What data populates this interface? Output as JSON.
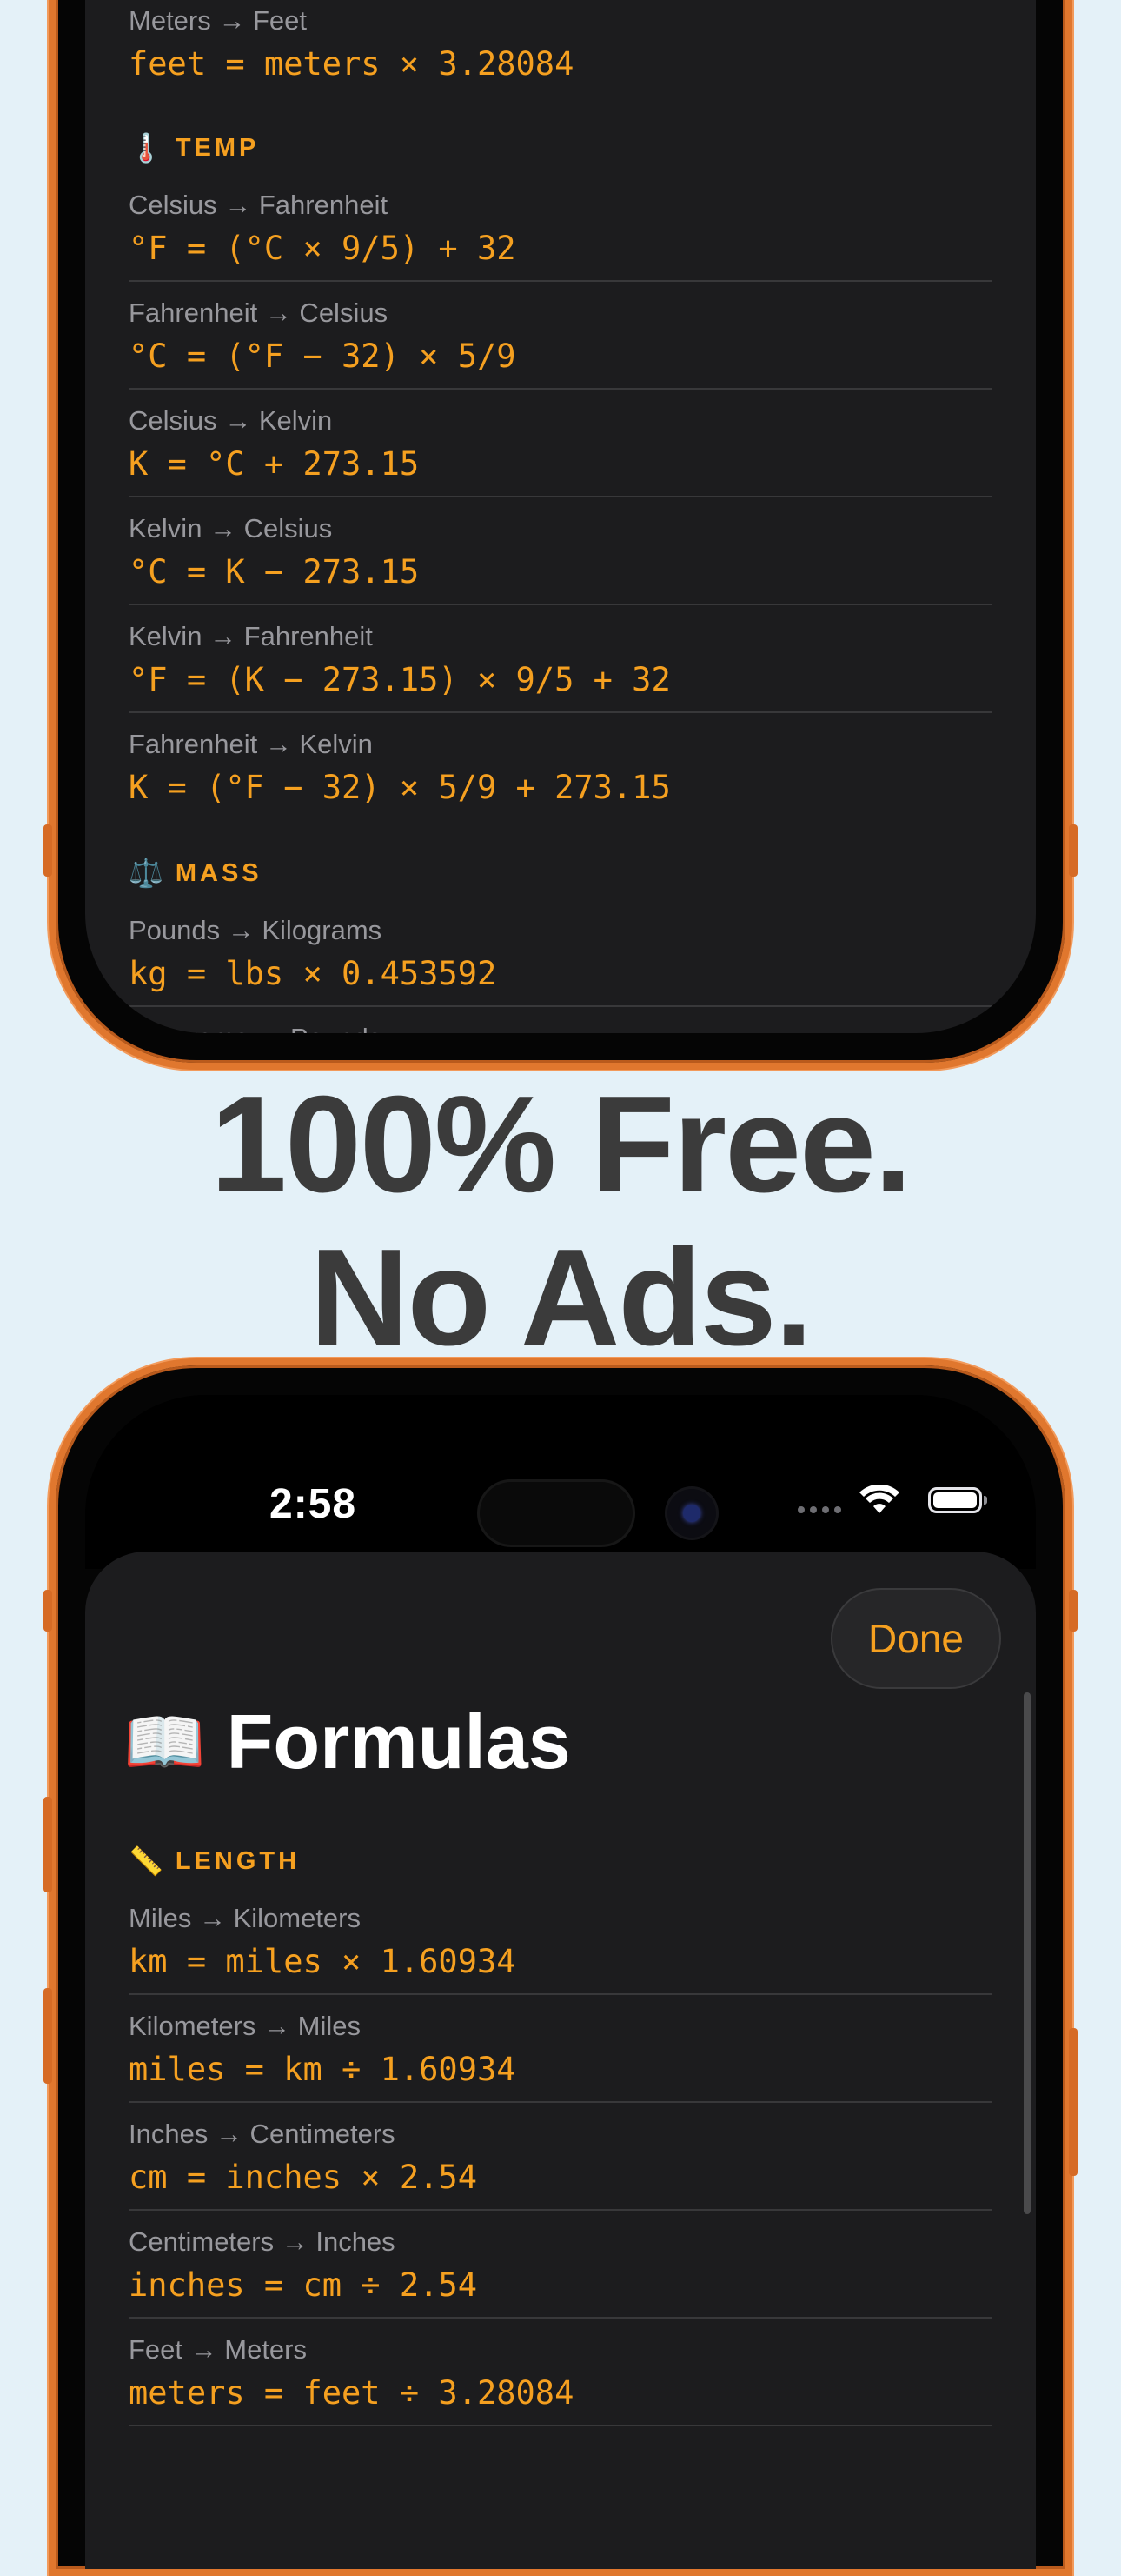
{
  "headline": {
    "line1": "100% Free.",
    "line2": "No Ads."
  },
  "top_phone": {
    "partial_row": {
      "label": "Meters → Feet",
      "formula": "feet = meters × 3.28084"
    },
    "temp_section": {
      "icon": "🌡️",
      "title": "TEMP",
      "rows": [
        {
          "label": "Celsius → Fahrenheit",
          "formula": "°F = (°C × 9/5) + 32"
        },
        {
          "label": "Fahrenheit → Celsius",
          "formula": "°C = (°F − 32) × 5/9"
        },
        {
          "label": "Celsius → Kelvin",
          "formula": "K = °C + 273.15"
        },
        {
          "label": "Kelvin → Celsius",
          "formula": "°C = K − 273.15"
        },
        {
          "label": "Kelvin → Fahrenheit",
          "formula": "°F = (K − 273.15) × 9/5 + 32"
        },
        {
          "label": "Fahrenheit → Kelvin",
          "formula": "K = (°F − 32) × 5/9 + 273.15"
        }
      ]
    },
    "mass_section": {
      "icon": "⚖️",
      "title": "MASS",
      "rows": [
        {
          "label": "Pounds → Kilograms",
          "formula": "kg = lbs × 0.453592"
        },
        {
          "label": "Kilograms → Pounds",
          "formula": ""
        }
      ]
    }
  },
  "bottom_phone": {
    "status_bar": {
      "time": "2:58"
    },
    "done_label": "Done",
    "title_icon": "📖",
    "title": "Formulas",
    "length_section": {
      "icon": "📏",
      "title": "LENGTH",
      "rows": [
        {
          "label": "Miles → Kilometers",
          "formula": "km = miles × 1.60934"
        },
        {
          "label": "Kilometers → Miles",
          "formula": "miles = km ÷ 1.60934"
        },
        {
          "label": "Inches → Centimeters",
          "formula": "cm = inches × 2.54"
        },
        {
          "label": "Centimeters → Inches",
          "formula": "inches = cm ÷ 2.54"
        },
        {
          "label": "Feet → Meters",
          "formula": "meters = feet ÷ 3.28084"
        }
      ]
    }
  },
  "colors": {
    "background": "#e4f1f8",
    "accent": "#f5a020",
    "frame": "#e0772e",
    "screen": "#1c1c1e"
  }
}
